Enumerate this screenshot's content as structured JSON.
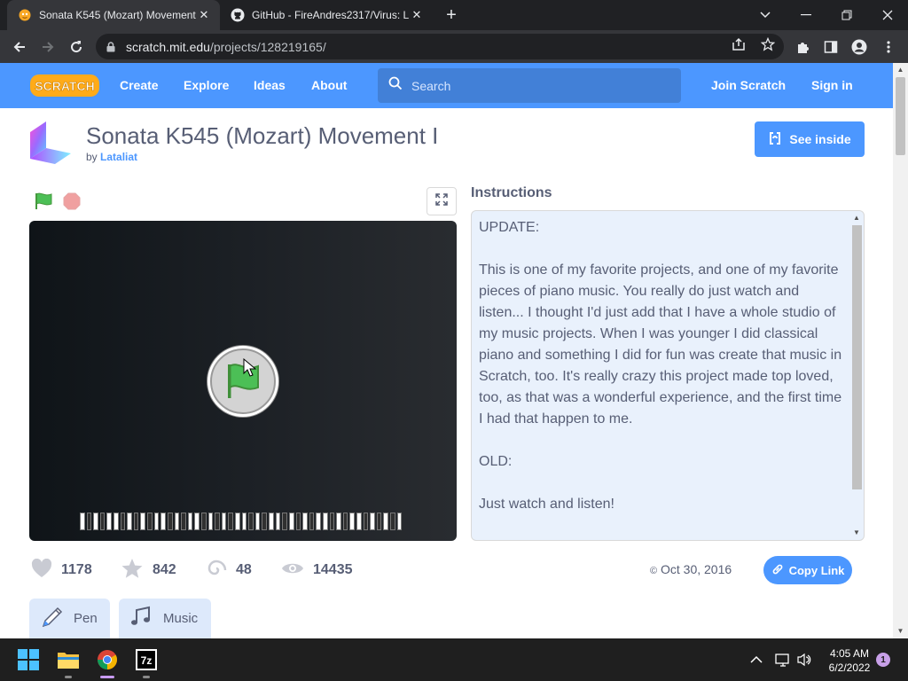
{
  "browser": {
    "tabs": [
      {
        "title": "Sonata K545 (Mozart) Movement I",
        "active": true,
        "icon": "scratch-cat-icon"
      },
      {
        "title": "GitHub - FireAndres2317/Virus: L",
        "active": false,
        "icon": "github-icon"
      }
    ],
    "url_host": "scratch.mit.edu",
    "url_path": "/projects/128219165/"
  },
  "nav": {
    "logo_text": "SCRATCH",
    "links": [
      "Create",
      "Explore",
      "Ideas",
      "About"
    ],
    "search_placeholder": "Search",
    "join": "Join Scratch",
    "signin": "Sign in"
  },
  "project": {
    "title": "Sonata K545 (Mozart) Movement I",
    "by": "by",
    "author": "Lataliat",
    "see_inside": "See inside",
    "instructions_label": "Instructions",
    "instructions": [
      "UPDATE:",
      "This is one of my favorite projects, and one of my favorite pieces of piano music. You really do just watch and listen... I thought I'd just add that I have a whole studio of my music projects. When I was younger I did classical piano and something I did for fun was create that music in Scratch, too. It's really crazy this project made top loved, too, as that was a wonderful experience, and the first time I had that happen to me.",
      "OLD:",
      "Just watch and listen!"
    ],
    "stats": {
      "loves": "1178",
      "favorites": "842",
      "remixes": "48",
      "views": "14435"
    },
    "date": "Oct 30, 2016",
    "copy_link": "Copy Link",
    "extensions": [
      "Pen",
      "Music"
    ]
  },
  "taskbar": {
    "time": "4:05 AM",
    "date": "6/2/2022",
    "notifications": "1",
    "apps": [
      "start-icon",
      "file-explorer-icon",
      "chrome-icon",
      "7zip-icon"
    ],
    "seven_zip_label": "7z"
  },
  "colors": {
    "scratch_blue": "#4c97ff",
    "text": "#575e75",
    "instructions_bg": "#e9f1fc"
  }
}
